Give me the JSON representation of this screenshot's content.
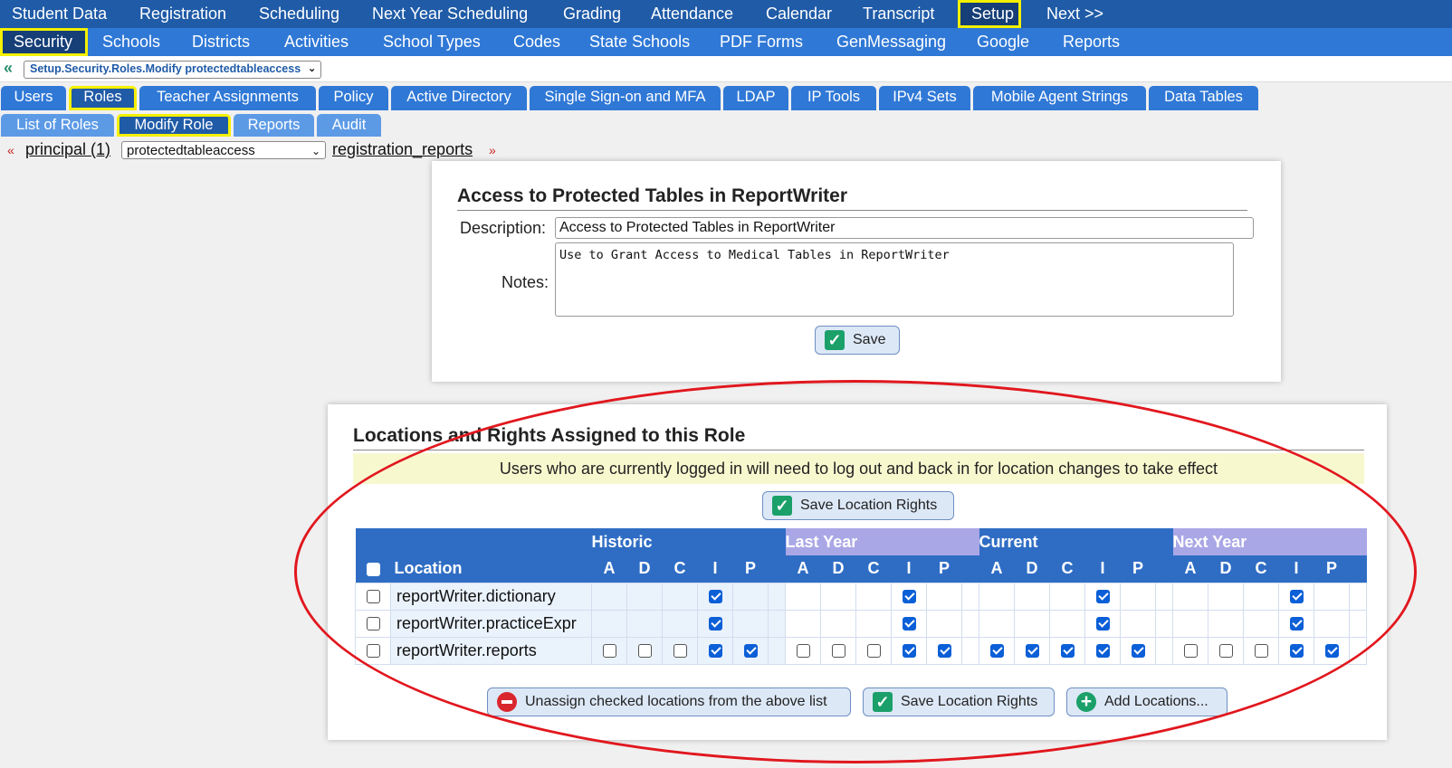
{
  "top_nav": [
    "Student Data",
    "Registration",
    "Scheduling",
    "Next Year Scheduling",
    "Grading",
    "Attendance",
    "Calendar",
    "Transcript",
    "Setup",
    "Next >>"
  ],
  "sub_nav": [
    "Security",
    "Schools",
    "Districts",
    "Activities",
    "School Types",
    "Codes",
    "State Schools",
    "PDF Forms",
    "GenMessaging",
    "Google",
    "Reports"
  ],
  "breadcrumb": {
    "value": "Setup.Security.Roles.Modify protectedtableaccess"
  },
  "security_tabs": [
    "Users",
    "Roles",
    "Teacher Assignments",
    "Policy",
    "Active Directory",
    "Single Sign-on and MFA",
    "LDAP",
    "IP Tools",
    "IPv4 Sets",
    "Mobile Agent Strings",
    "Data Tables"
  ],
  "role_tabs": [
    "List of Roles",
    "Modify Role",
    "Reports",
    "Audit"
  ],
  "pager": {
    "prev": "principal (1)",
    "current": "protectedtableaccess",
    "next": "registration_reports"
  },
  "role_form": {
    "title": "Access to Protected Tables in ReportWriter",
    "description_label": "Description:",
    "description_value": "Access to Protected Tables in ReportWriter",
    "notes_label": "Notes:",
    "notes_value": "Use to Grant Access to Medical Tables in ReportWriter",
    "save_label": "Save"
  },
  "locations": {
    "title": "Locations and Rights Assigned to this Role",
    "notice": "Users who are currently logged in will need to log out and back in for location changes to take effect",
    "save_top_label": "Save Location Rights",
    "location_header": "Location",
    "groups": [
      "Historic",
      "Last Year",
      "Current",
      "Next Year"
    ],
    "right_letters": [
      "A",
      "D",
      "C",
      "I",
      "P"
    ],
    "rows": [
      {
        "name": "reportWriter.dictionary",
        "rights": [
          [
            null,
            null,
            null,
            true,
            null
          ],
          [
            null,
            null,
            null,
            true,
            null
          ],
          [
            null,
            null,
            null,
            true,
            null
          ],
          [
            null,
            null,
            null,
            true,
            null
          ]
        ]
      },
      {
        "name": "reportWriter.practiceExpr",
        "rights": [
          [
            null,
            null,
            null,
            true,
            null
          ],
          [
            null,
            null,
            null,
            true,
            null
          ],
          [
            null,
            null,
            null,
            true,
            null
          ],
          [
            null,
            null,
            null,
            true,
            null
          ]
        ]
      },
      {
        "name": "reportWriter.reports",
        "rights": [
          [
            false,
            false,
            false,
            true,
            true
          ],
          [
            false,
            false,
            false,
            true,
            true
          ],
          [
            true,
            true,
            true,
            true,
            true
          ],
          [
            false,
            false,
            false,
            true,
            true
          ]
        ]
      }
    ],
    "unassign_label": "Unassign checked locations from the above list",
    "save_bottom_label": "Save Location Rights",
    "add_label": "Add Locations..."
  },
  "colors": {
    "nav_dark": "#1f5ba7",
    "nav_mid": "#2f78d6",
    "highlight": "#f4f000",
    "annotation_red": "#e1171e"
  }
}
